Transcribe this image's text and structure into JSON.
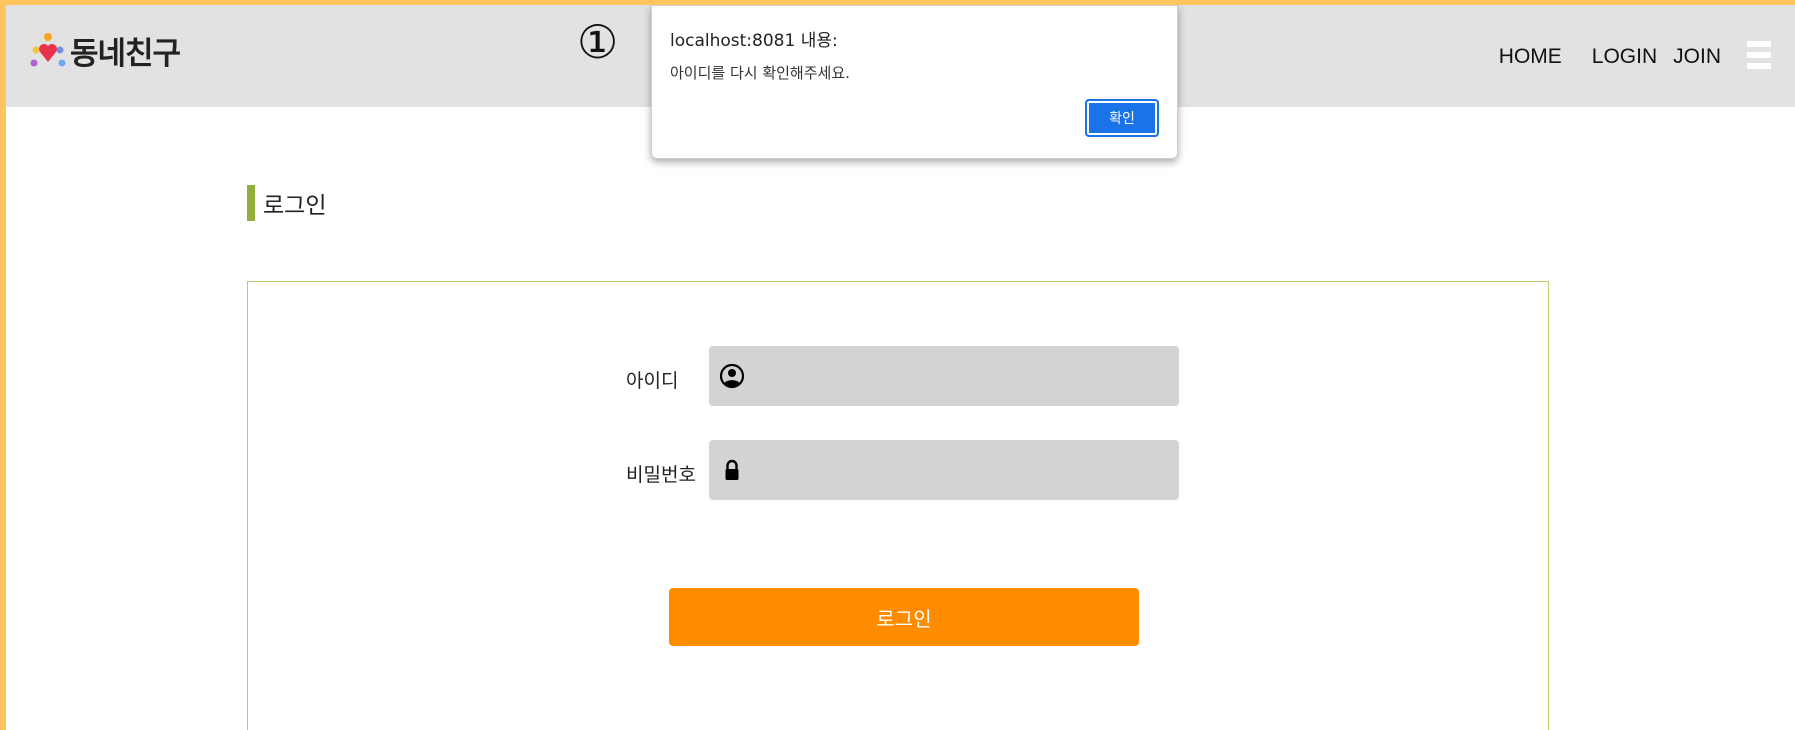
{
  "header": {
    "logo_text": "동네친구",
    "step_marker": "①",
    "nav": {
      "home": "HOME",
      "login": "LOGIN",
      "join": "JOIN"
    },
    "menu_icon": "hamburger-menu-icon"
  },
  "section": {
    "title": "로그인"
  },
  "form": {
    "id_label": "아이디",
    "id_icon": "user-circle-icon",
    "id_value": "",
    "password_label": "비밀번호",
    "password_icon": "lock-icon",
    "password_value": "",
    "submit_label": "로그인"
  },
  "alert_dialog": {
    "title": "localhost:8081 내용:",
    "message": "아이디를 다시 확인해주세요.",
    "ok_label": "확인"
  },
  "colors": {
    "outer_border": "#ffc65e",
    "header_bg": "#e2e2e2",
    "title_accent": "#93ae3c",
    "box_border": "#b8d06c",
    "input_bg": "#d3d3d3",
    "primary_button": "#ff8c00",
    "dialog_button": "#1a73e8"
  }
}
